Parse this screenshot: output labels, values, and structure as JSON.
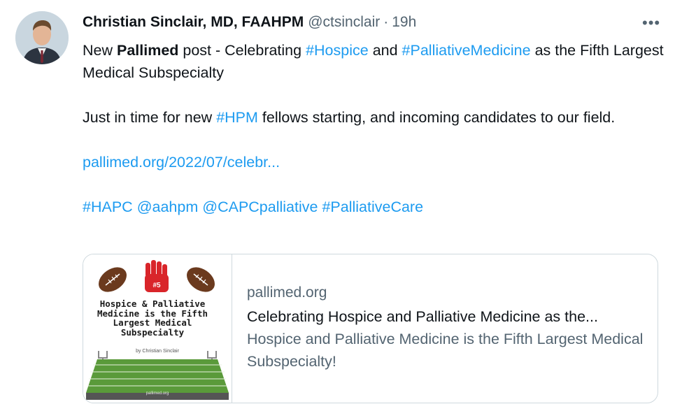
{
  "tweet": {
    "author_name": "Christian Sinclair, MD, FAAHPM",
    "handle": "@ctsinclair",
    "separator": "·",
    "time": "19h",
    "more_icon": "more-icon",
    "line1_a": "New ",
    "line1_bold": "Pallimed",
    "line1_b": " post - Celebrating ",
    "tag_hospice": "#Hospice",
    "line1_c": " and ",
    "tag_palliative_medicine": "#PalliativeMedicine",
    "line1_d": " as the Fifth Largest Medical Subspecialty",
    "line2_a": "Just in time for new ",
    "tag_hpm": "#HPM",
    "line2_b": " fellows starting, and incoming candidates to our field.",
    "link": "pallimed.org/2022/07/celebr...",
    "tag_hapc": "#HAPC",
    "mention_aahpm": "@aahpm",
    "mention_capc": "@CAPCpalliative",
    "tag_palliative_care": "#PalliativeCare"
  },
  "card": {
    "domain": "pallimed.org",
    "title": "Celebrating Hospice and Palliative Medicine as the...",
    "description": "Hospice and Palliative Medicine is the Fifth Largest Medical Subspecialty!",
    "image": {
      "glove_text": "#5",
      "title_text": "Hospice & Palliative Medicine is the Fifth Largest Medical Subspecialty",
      "byline": "by Christian Sinclair",
      "domain": "pallimed.org"
    }
  },
  "colors": {
    "link": "#1d9bf0",
    "secondary": "#536471",
    "field": "#5a9a3a",
    "football": "#6b3a1e",
    "glove": "#d9252a"
  }
}
